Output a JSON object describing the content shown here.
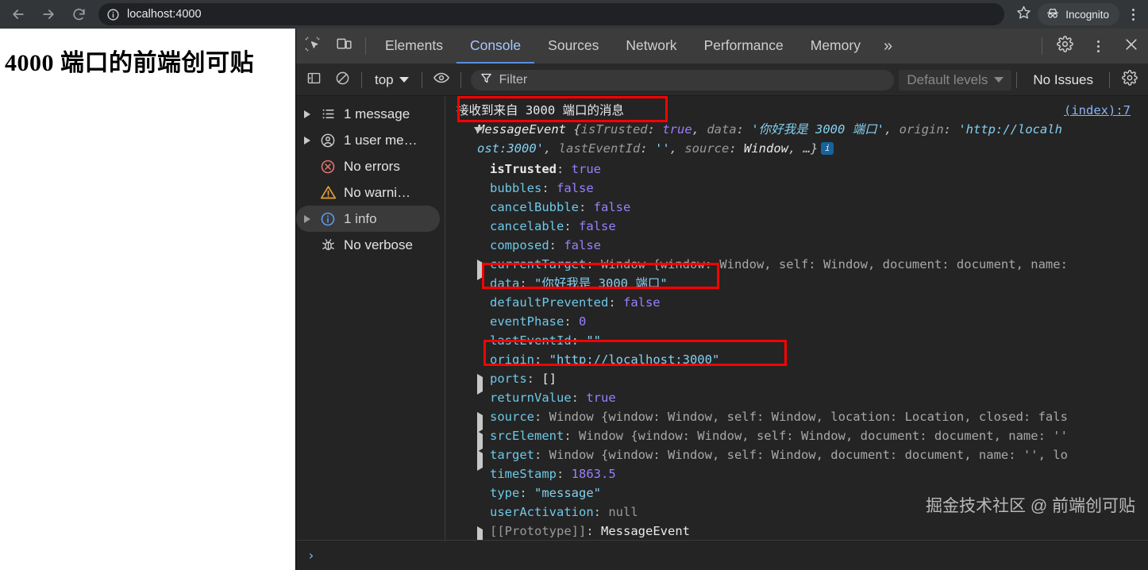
{
  "browser": {
    "back_icon": "back-arrow-icon",
    "forward_icon": "forward-arrow-icon",
    "reload_icon": "reload-icon",
    "site_info_icon": "info-circle-icon",
    "url": "localhost:4000",
    "star_icon": "bookmark-star-icon",
    "incognito_label": "Incognito",
    "incognito_icon": "incognito-hat-icon",
    "menu_icon": "kebab-menu-icon"
  },
  "page": {
    "heading": "4000 端口的前端创可贴"
  },
  "devtools": {
    "inspect_icon": "inspect-element-icon",
    "device_icon": "device-toolbar-icon",
    "tabs": [
      {
        "label": "Elements",
        "active": false
      },
      {
        "label": "Console",
        "active": true
      },
      {
        "label": "Sources",
        "active": false
      },
      {
        "label": "Network",
        "active": false
      },
      {
        "label": "Performance",
        "active": false
      },
      {
        "label": "Memory",
        "active": false
      }
    ],
    "more_tabs_label": "»",
    "settings_icon": "gear-icon",
    "kebab_icon": "kebab-menu-icon",
    "close_icon": "close-icon",
    "console_toolbar": {
      "sidebar_toggle_icon": "show-console-sidebar-icon",
      "clear_icon": "clear-console-icon",
      "context_value": "top",
      "eye_icon": "live-expression-icon",
      "filter_icon": "filter-funnel-icon",
      "filter_placeholder": "Filter",
      "levels_value": "Default levels",
      "issues_label": "No Issues",
      "settings_icon": "gear-icon"
    },
    "sidebar": [
      {
        "label": "1 message",
        "icon": "list-icon",
        "expandable": true,
        "selected": false
      },
      {
        "label": "1 user me…",
        "icon": "user-icon",
        "expandable": true,
        "selected": false
      },
      {
        "label": "No errors",
        "icon": "error-icon",
        "expandable": false,
        "selected": false
      },
      {
        "label": "No warni…",
        "icon": "warning-icon",
        "expandable": false,
        "selected": false
      },
      {
        "label": "1 info",
        "icon": "info-icon",
        "expandable": true,
        "selected": true
      },
      {
        "label": "No verbose",
        "icon": "bug-icon",
        "expandable": false,
        "selected": false
      }
    ],
    "console": {
      "source_link": "(index):7",
      "log_message": "接收到来自 3000 端口的消息",
      "object_preview_line1_parts": {
        "class": "MessageEvent",
        "open": " {",
        "k1": "isTrusted",
        "v1": "true",
        "k2": "data",
        "v2": "'你好我是 3000 端口'",
        "k3": "origin",
        "v3": "'http://localh"
      },
      "object_preview_line2_parts": {
        "v3_cont": "ost:3000'",
        "k4": "lastEventId",
        "v4": "''",
        "k5": "source",
        "v5": "Window",
        "ellipsis": "…}"
      },
      "info_badge": "i",
      "properties": [
        {
          "name": "isTrusted",
          "own": true,
          "expandable": false,
          "value": "true",
          "kind": "kw"
        },
        {
          "name": "bubbles",
          "own": false,
          "expandable": false,
          "value": "false",
          "kind": "kw"
        },
        {
          "name": "cancelBubble",
          "own": false,
          "expandable": false,
          "value": "false",
          "kind": "kw"
        },
        {
          "name": "cancelable",
          "own": false,
          "expandable": false,
          "value": "false",
          "kind": "kw"
        },
        {
          "name": "composed",
          "own": false,
          "expandable": false,
          "value": "false",
          "kind": "kw"
        },
        {
          "name": "currentTarget",
          "own": false,
          "expandable": true,
          "value": "Window {window: Window, self: Window, document: document, name:",
          "kind": "obj"
        },
        {
          "name": "data",
          "own": false,
          "expandable": false,
          "value": "\"你好我是 3000 端口\"",
          "kind": "str"
        },
        {
          "name": "defaultPrevented",
          "own": false,
          "expandable": false,
          "value": "false",
          "kind": "kw"
        },
        {
          "name": "eventPhase",
          "own": false,
          "expandable": false,
          "value": "0",
          "kind": "num"
        },
        {
          "name": "lastEventId",
          "own": false,
          "expandable": false,
          "value": "\"\"",
          "kind": "str"
        },
        {
          "name": "origin",
          "own": false,
          "expandable": false,
          "value": "\"http://localhost:3000\"",
          "kind": "str"
        },
        {
          "name": "ports",
          "own": false,
          "expandable": true,
          "value": "[]",
          "kind": "obj-white"
        },
        {
          "name": "returnValue",
          "own": false,
          "expandable": false,
          "value": "true",
          "kind": "kw"
        },
        {
          "name": "source",
          "own": false,
          "expandable": true,
          "value": "Window {window: Window, self: Window, location: Location, closed: fals",
          "kind": "obj"
        },
        {
          "name": "srcElement",
          "own": false,
          "expandable": true,
          "value": "Window {window: Window, self: Window, document: document, name: ''",
          "kind": "obj"
        },
        {
          "name": "target",
          "own": false,
          "expandable": true,
          "value": "Window {window: Window, self: Window, document: document, name: '', lo",
          "kind": "obj"
        },
        {
          "name": "timeStamp",
          "own": false,
          "expandable": false,
          "value": "1863.5",
          "kind": "num"
        },
        {
          "name": "type",
          "own": false,
          "expandable": false,
          "value": "\"message\"",
          "kind": "str"
        },
        {
          "name": "userActivation",
          "own": false,
          "expandable": false,
          "value": "null",
          "kind": "null"
        },
        {
          "name": "[[Prototype]]",
          "own": false,
          "expandable": true,
          "value": "MessageEvent",
          "kind": "proto",
          "proto": true
        }
      ],
      "prompt_caret": "›"
    },
    "annotations": {
      "color": "#ff0000",
      "boxes": [
        {
          "name": "highlight-log-message"
        },
        {
          "name": "highlight-data-property"
        },
        {
          "name": "highlight-origin-property"
        }
      ]
    }
  },
  "watermark": "掘金技术社区 @ 前端创可贴"
}
